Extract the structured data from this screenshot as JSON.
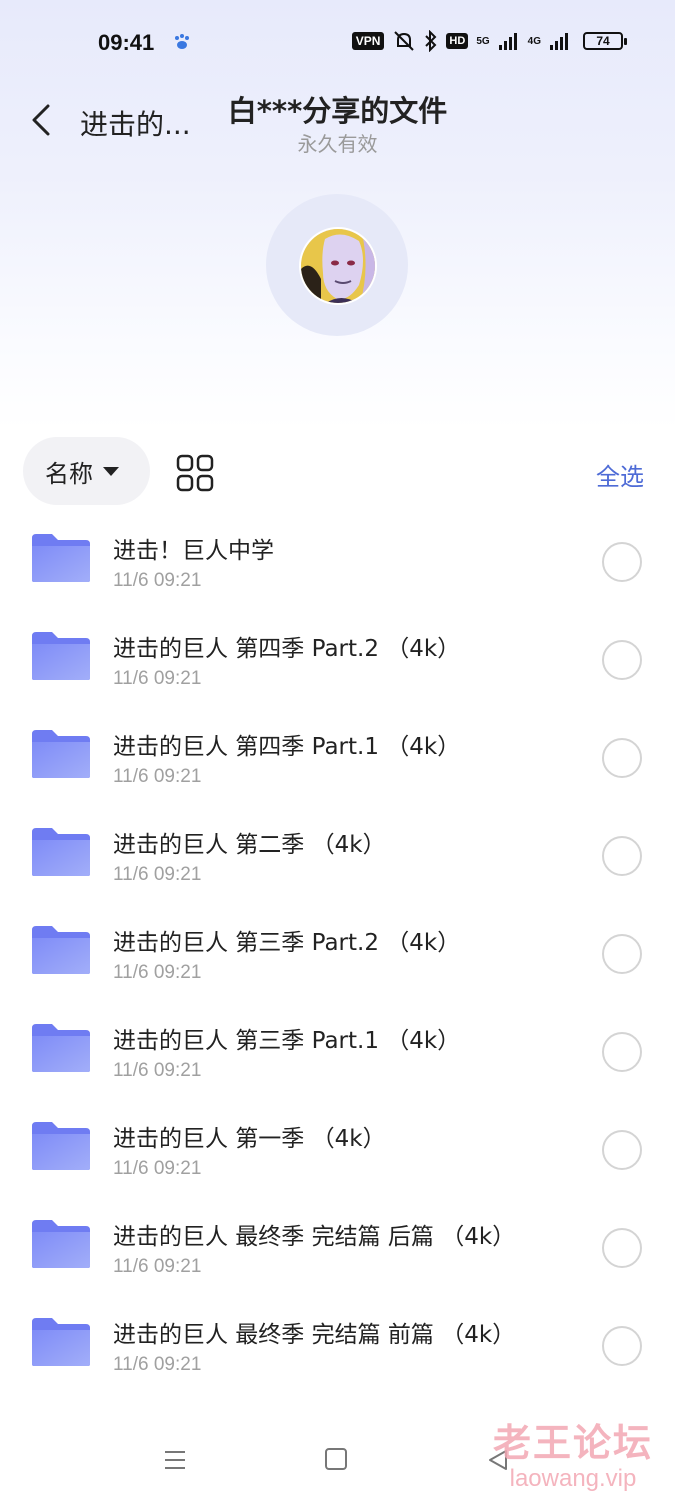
{
  "status_bar": {
    "time": "09:41",
    "vpn": "VPN",
    "hd": "HD",
    "net_5g": "5G",
    "net_4g": "4G",
    "battery": "74",
    "icons": [
      "paw-icon",
      "mute-icon",
      "bluetooth-icon",
      "signal-icon",
      "signal-icon"
    ]
  },
  "header": {
    "back_label": "进击的...",
    "title": "白***分享的文件",
    "subtitle": "永久有效"
  },
  "toolbar": {
    "sort_label": "名称",
    "select_all": "全选"
  },
  "files": [
    {
      "name": "进击！巨人中学",
      "date": "11/6 09:21"
    },
    {
      "name": "进击的巨人 第四季 Part.2 （4k）",
      "date": "11/6 09:21"
    },
    {
      "name": "进击的巨人 第四季 Part.1 （4k）",
      "date": "11/6 09:21"
    },
    {
      "name": "进击的巨人 第二季 （4k）",
      "date": "11/6 09:21"
    },
    {
      "name": "进击的巨人 第三季 Part.2 （4k）",
      "date": "11/6 09:21"
    },
    {
      "name": "进击的巨人 第三季 Part.1 （4k）",
      "date": "11/6 09:21"
    },
    {
      "name": "进击的巨人 第一季 （4k）",
      "date": "11/6 09:21"
    },
    {
      "name": "进击的巨人 最终季 完结篇 后篇 （4k）",
      "date": "11/6 09:21"
    },
    {
      "name": "进击的巨人 最终季 完结篇 前篇 （4k）",
      "date": "11/6 09:21"
    }
  ],
  "watermark": {
    "cn": "老王论坛",
    "en": "laowang.vip"
  },
  "colors": {
    "accent": "#4e6bd6",
    "folder": "#7b86f5",
    "header_bg": "#e7eafb"
  }
}
